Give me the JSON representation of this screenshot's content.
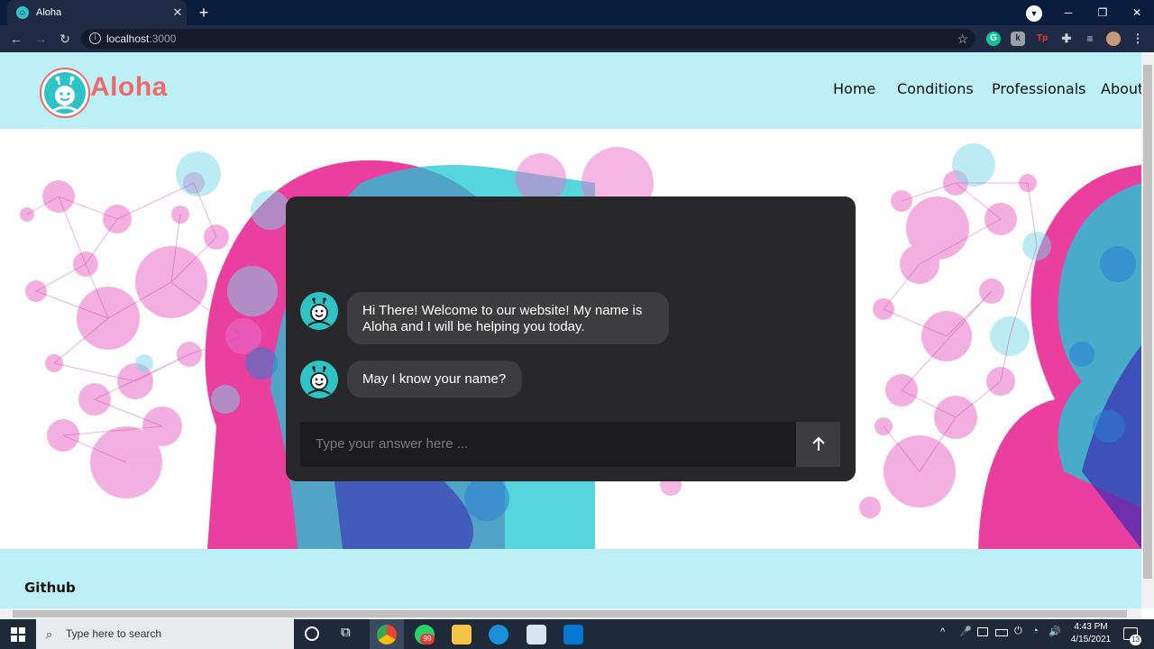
{
  "browser": {
    "tab_title": "Aloha",
    "url_host": "localhost",
    "url_port": ":3000"
  },
  "nav": {
    "brand": "Aloha",
    "links": [
      "Home",
      "Conditions",
      "Professionals",
      "About"
    ]
  },
  "chat": {
    "messages": [
      "Hi There! Welcome to our website! My name is Aloha and I will be helping you today.",
      "May I know your name?"
    ],
    "input_placeholder": "Type your answer here ..."
  },
  "footer": {
    "link": "Github"
  },
  "taskbar": {
    "search_placeholder": "Type here to search",
    "whatsapp_badge": "99",
    "time": "4:43 PM",
    "date": "4/15/2021",
    "notifications": "13"
  },
  "colors": {
    "navbar": "#bdf0f6",
    "brand": "#ef6b6b",
    "accent": "#2ec4c6",
    "chat_bg": "#28282b"
  }
}
